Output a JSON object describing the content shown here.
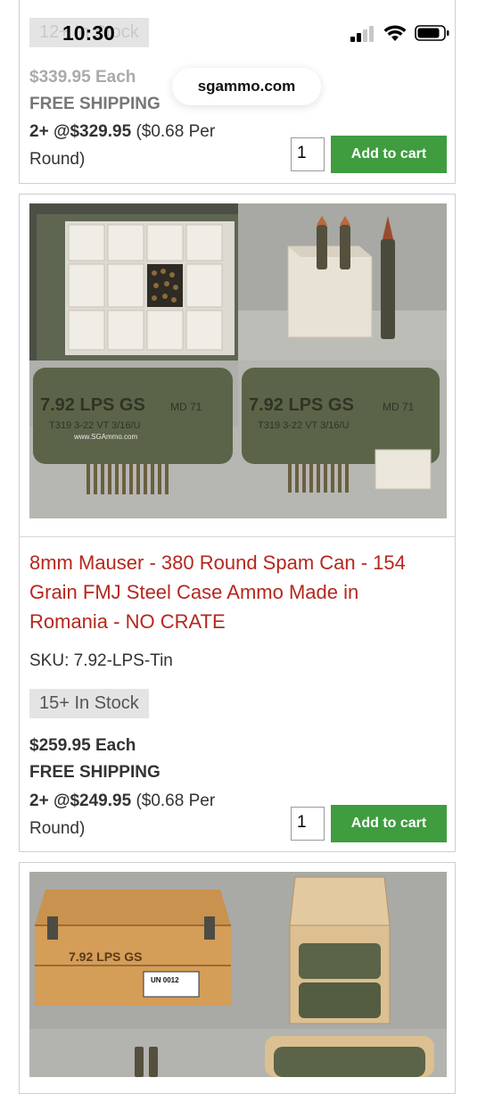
{
  "status": {
    "time": "10:30"
  },
  "browser": {
    "url": "sgammo.com"
  },
  "top_card": {
    "stock": "12+ In Stock",
    "price_each": "$339.95 Each",
    "shipping": "FREE SHIPPING",
    "bulk_price": "2+ @$329.95",
    "per_round": "($0.68 Per Round)",
    "qty": "1",
    "cart_label": "Add to cart"
  },
  "main_card": {
    "image_labels": {
      "can1": "7.92 LPS GS  MD 71",
      "can2": "7.92 LPS GS  MD 71",
      "lot1": "T319 3-22  VT 3/16/U",
      "lot2": "T319 3-22  VT 3/16/U",
      "watermark": "www.SGAmmo.com"
    },
    "title": "8mm Mauser - 380 Round Spam Can - 154 Grain FMJ Steel Case Ammo Made in Romania - NO CRATE",
    "sku": "SKU: 7.92-LPS-Tin",
    "stock": "15+ In Stock",
    "price_each": "$259.95 Each",
    "shipping": "FREE SHIPPING",
    "bulk_price": "2+ @$249.95",
    "per_round": "($0.68 Per Round)",
    "qty": "1",
    "cart_label": "Add to cart"
  },
  "bottom_card": {
    "crate_label": "7.92 LPS GS",
    "tag_label": "UN 0012"
  }
}
